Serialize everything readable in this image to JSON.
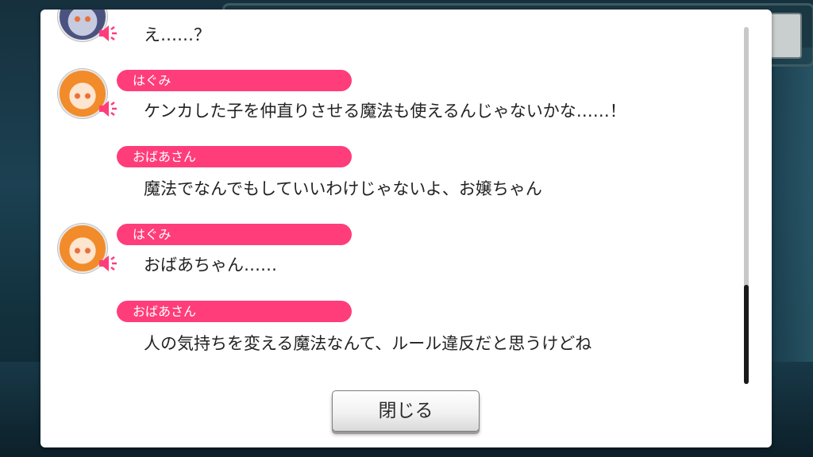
{
  "background": {
    "accent": "#1c4152"
  },
  "log": {
    "accent_color": "#ff3d7a",
    "entries": [
      {
        "speaker": "",
        "text": "え……？",
        "avatar": "character-avatar"
      },
      {
        "speaker": "はぐみ",
        "text": "ケンカした子を仲直りさせる魔法も使えるんじゃないかな……！",
        "avatar": "hagumi-avatar"
      },
      {
        "speaker": "おばあさん",
        "text": "魔法でなんでもしていいわけじゃないよ、お嬢ちゃん",
        "avatar": ""
      },
      {
        "speaker": "はぐみ",
        "text": "おばあちゃん……",
        "avatar": "hagumi-avatar"
      },
      {
        "speaker": "おばあさん",
        "text": "人の気持ちを変える魔法なんて、ルール違反だと思うけどね",
        "avatar": ""
      }
    ]
  },
  "close_button": {
    "label": "閉じる"
  },
  "icons": {
    "voice": "speaker-icon"
  }
}
